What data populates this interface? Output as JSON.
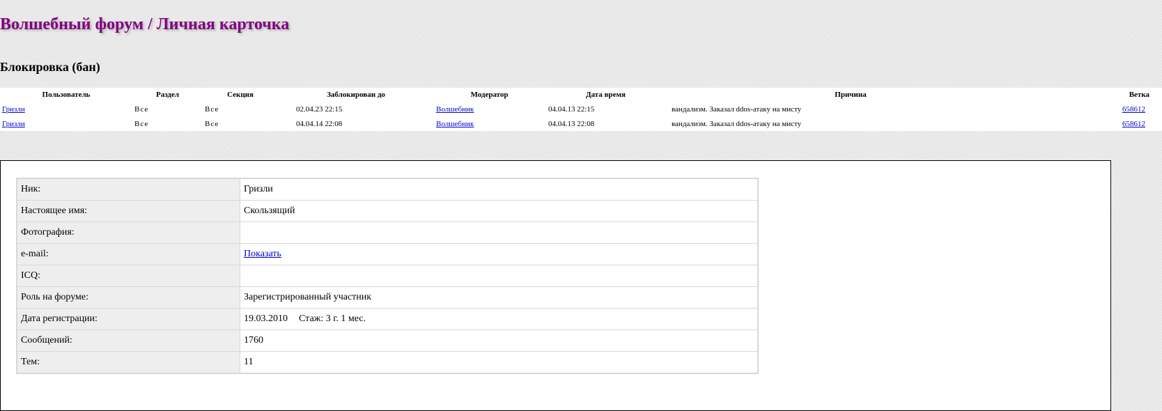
{
  "header": {
    "title": "Волшебный форум / Личная карточка"
  },
  "ban_section": {
    "title": "Блокировка (бан)",
    "columns": [
      "Пользователь",
      "Раздел",
      "Секция",
      "Заблокирован до",
      "Модератор",
      "Дата время",
      "Причина",
      "Ветка"
    ],
    "rows": [
      {
        "user": "Гризли",
        "razdel": "Все",
        "section": "Все",
        "blocked_until": "02.04.23 22:15",
        "moderator": "Волшебник",
        "datetime": "04.04.13 22:15",
        "reason": "вандализм. Заказал ddos-атаку на мисту",
        "thread": "658612"
      },
      {
        "user": "Гризли",
        "razdel": "Все",
        "section": "Все",
        "blocked_until": "04.04.14 22:08",
        "moderator": "Волшебник",
        "datetime": "04.04.13 22:08",
        "reason": "вандализм. Заказал ddos-атаку на мисту",
        "thread": "658612"
      }
    ]
  },
  "profile": {
    "rows": [
      {
        "label": "Ник:",
        "value": "Гризли"
      },
      {
        "label": "Настоящее имя:",
        "value": "Скользящий"
      },
      {
        "label": "Фотография:",
        "value": ""
      },
      {
        "label": "e-mail:",
        "value": "Показать"
      },
      {
        "label": "ICQ:",
        "value": ""
      },
      {
        "label": "Роль на форуме:",
        "value": "Зарегистрированный участник"
      },
      {
        "label": "Дата регистрации:",
        "value": "19.03.2010",
        "extra": "Стаж: 3 г. 1 мес."
      },
      {
        "label": "Сообщений:",
        "value": "1760"
      },
      {
        "label": "Тем:",
        "value": "11"
      }
    ]
  }
}
